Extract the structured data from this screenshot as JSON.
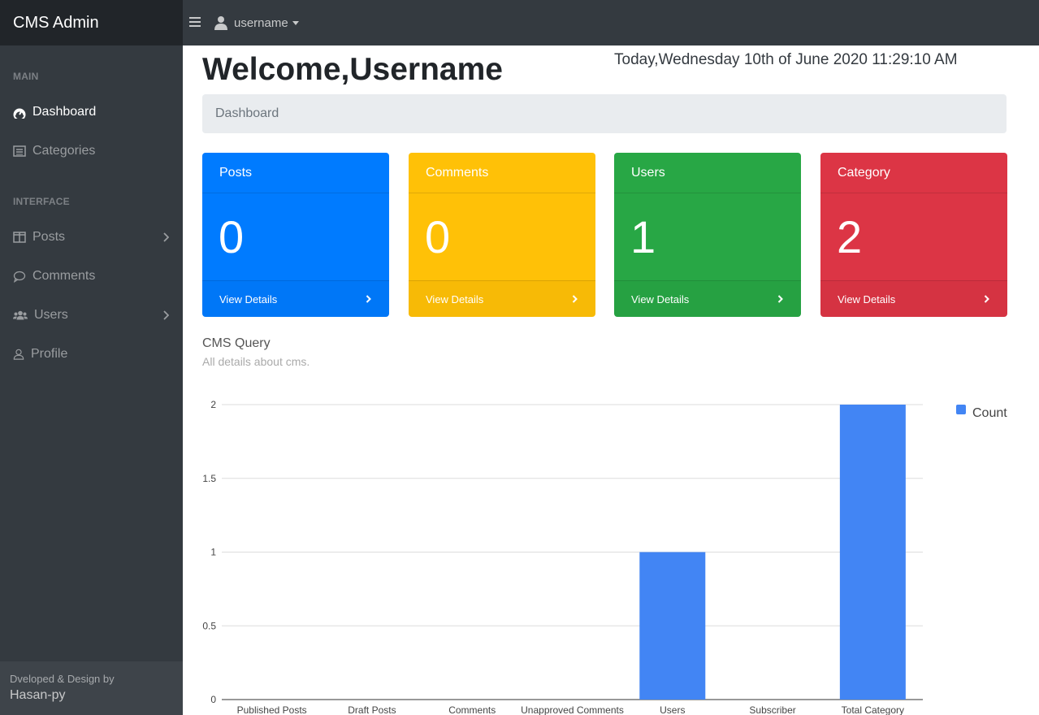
{
  "app": {
    "title": "CMS Admin"
  },
  "topbar": {
    "username": "username"
  },
  "sidebar": {
    "heading_main": "MAIN",
    "heading_interface": "INTERFACE",
    "items": [
      {
        "label": "Dashboard",
        "icon": "dashboard-icon",
        "active": true
      },
      {
        "label": "Categories",
        "icon": "list-icon"
      },
      {
        "label": "Posts",
        "icon": "columns-icon",
        "has_submenu": true
      },
      {
        "label": "Comments",
        "icon": "comment-icon"
      },
      {
        "label": "Users",
        "icon": "users-icon",
        "has_submenu": true
      },
      {
        "label": "Profile",
        "icon": "user-icon"
      }
    ],
    "footer_line1": "Dveloped & Design by",
    "footer_line2": "Hasan-py"
  },
  "page": {
    "welcome": "Welcome,Username",
    "datetime": "Today,Wednesday 10th of June 2020 11:29:10 AM",
    "breadcrumb": "Dashboard"
  },
  "cards": [
    {
      "title": "Posts",
      "value": "0",
      "link": "View Details",
      "color": "#007bff"
    },
    {
      "title": "Comments",
      "value": "0",
      "link": "View Details",
      "color": "#ffc107"
    },
    {
      "title": "Users",
      "value": "1",
      "link": "View Details",
      "color": "#28a745"
    },
    {
      "title": "Category",
      "value": "2",
      "link": "View Details",
      "color": "#dc3545"
    }
  ],
  "chart_section": {
    "title": "CMS Query",
    "subtitle": "All details about cms."
  },
  "chart_data": {
    "type": "bar",
    "categories": [
      "Published Posts",
      "Draft Posts",
      "Comments",
      "Unapproved Comments",
      "Users",
      "Subscriber",
      "Total Category"
    ],
    "series": [
      {
        "name": "Count",
        "values": [
          0,
          0,
          0,
          0,
          1,
          0,
          2
        ],
        "color": "#4285f4"
      }
    ],
    "yticks": [
      "0",
      "0.5",
      "1",
      "1.5",
      "2"
    ],
    "ylim": [
      0,
      2
    ],
    "legend": "right",
    "grid": true
  }
}
